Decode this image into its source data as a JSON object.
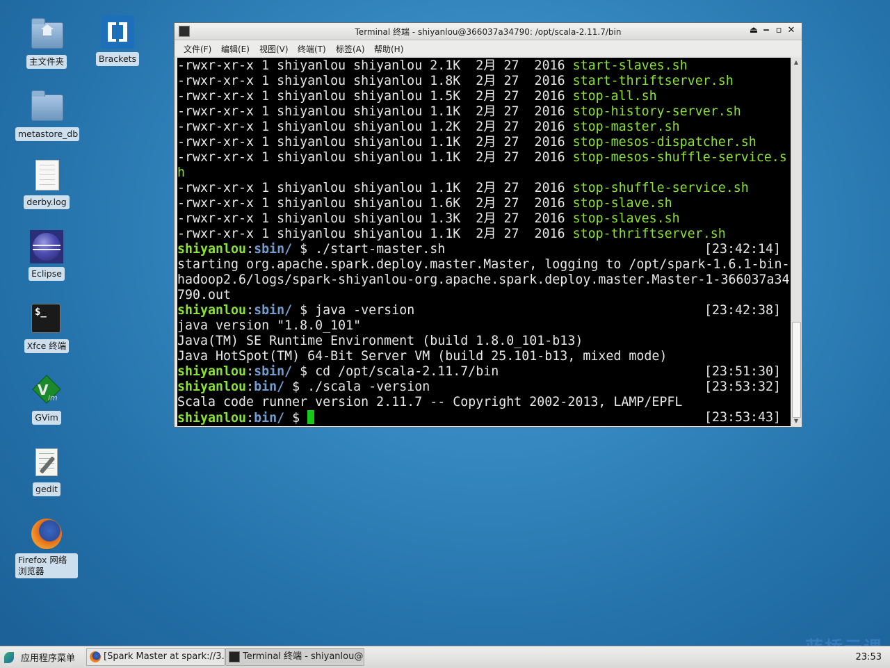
{
  "desktop": {
    "icons": [
      {
        "label": "主文件夹",
        "icon": "home-folder-icon"
      },
      {
        "label": "Brackets",
        "icon": "brackets-icon"
      },
      {
        "label": "metastore_db",
        "icon": "folder-icon"
      },
      {
        "label": "derby.log",
        "icon": "text-file-icon"
      },
      {
        "label": "Eclipse",
        "icon": "eclipse-icon"
      },
      {
        "label": "Xfce 终端",
        "icon": "terminal-icon"
      },
      {
        "label": "GVim",
        "icon": "gvim-icon"
      },
      {
        "label": "gedit",
        "icon": "gedit-icon"
      },
      {
        "label": "Firefox 网络浏览器",
        "icon": "firefox-icon"
      }
    ]
  },
  "window": {
    "title": "Terminal 终端 - shiyanlou@366037a34790: /opt/scala-2.11.7/bin",
    "menu": [
      "文件(F)",
      "编辑(E)",
      "视图(V)",
      "终端(T)",
      "标签(A)",
      "帮助(H)"
    ],
    "file_lines": [
      {
        "perm": "-rwxr-xr-x 1 shiyanlou shiyanlou 2.1K  2月 27  2016 ",
        "name": "start-slaves.sh"
      },
      {
        "perm": "-rwxr-xr-x 1 shiyanlou shiyanlou 1.8K  2月 27  2016 ",
        "name": "start-thriftserver.sh"
      },
      {
        "perm": "-rwxr-xr-x 1 shiyanlou shiyanlou 1.5K  2月 27  2016 ",
        "name": "stop-all.sh"
      },
      {
        "perm": "-rwxr-xr-x 1 shiyanlou shiyanlou 1.1K  2月 27  2016 ",
        "name": "stop-history-server.sh"
      },
      {
        "perm": "-rwxr-xr-x 1 shiyanlou shiyanlou 1.2K  2月 27  2016 ",
        "name": "stop-master.sh"
      },
      {
        "perm": "-rwxr-xr-x 1 shiyanlou shiyanlou 1.1K  2月 27  2016 ",
        "name": "stop-mesos-dispatcher.sh"
      },
      {
        "perm": "-rwxr-xr-x 1 shiyanlou shiyanlou 1.1K  2月 27  2016 ",
        "name": "stop-mesos-shuffle-service.s"
      },
      {
        "perm": "",
        "name": "h"
      },
      {
        "perm": "-rwxr-xr-x 1 shiyanlou shiyanlou 1.1K  2月 27  2016 ",
        "name": "stop-shuffle-service.sh"
      },
      {
        "perm": "-rwxr-xr-x 1 shiyanlou shiyanlou 1.6K  2月 27  2016 ",
        "name": "stop-slave.sh"
      },
      {
        "perm": "-rwxr-xr-x 1 shiyanlou shiyanlou 1.3K  2月 27  2016 ",
        "name": "stop-slaves.sh"
      },
      {
        "perm": "-rwxr-xr-x 1 shiyanlou shiyanlou 1.1K  2月 27  2016 ",
        "name": "stop-thriftserver.sh"
      }
    ],
    "prompt_user": "shiyanlou",
    "prompt_sep": ":",
    "cmd1": {
      "dir": "sbin/",
      "cmd": " $ ./start-master.sh",
      "time": "[23:42:14]"
    },
    "out1": [
      "starting org.apache.spark.deploy.master.Master, logging to /opt/spark-1.6.1-bin-",
      "hadoop2.6/logs/spark-shiyanlou-org.apache.spark.deploy.master.Master-1-366037a34",
      "790.out"
    ],
    "cmd2": {
      "dir": "sbin/",
      "cmd": " $ java -version",
      "time": "[23:42:38]"
    },
    "out2": [
      "java version \"1.8.0_101\"",
      "Java(TM) SE Runtime Environment (build 1.8.0_101-b13)",
      "Java HotSpot(TM) 64-Bit Server VM (build 25.101-b13, mixed mode)"
    ],
    "cmd3": {
      "dir": "sbin/",
      "cmd": " $ cd /opt/scala-2.11.7/bin",
      "time": "[23:51:30]"
    },
    "cmd4": {
      "dir": "bin/",
      "cmd": " $ ./scala -version",
      "time": "[23:53:32]"
    },
    "out4": [
      "Scala code runner version 2.11.7 -- Copyright 2002-2013, LAMP/EPFL"
    ],
    "cmd5": {
      "dir": "bin/",
      "cmd": " $ ",
      "time": "[23:53:43]"
    }
  },
  "taskbar": {
    "app_menu": "应用程序菜单",
    "tasks": [
      "[Spark Master at spark://3…",
      "Terminal 终端 - shiyanlou@…"
    ],
    "clock": "23:53"
  },
  "watermark": "蓝桥云课",
  "colors": {
    "terminal_bg": "#000000",
    "filename": "#8ae234",
    "prompt_user": "#8ae234",
    "prompt_dir": "#729fcf",
    "cursor": "#18c818"
  }
}
